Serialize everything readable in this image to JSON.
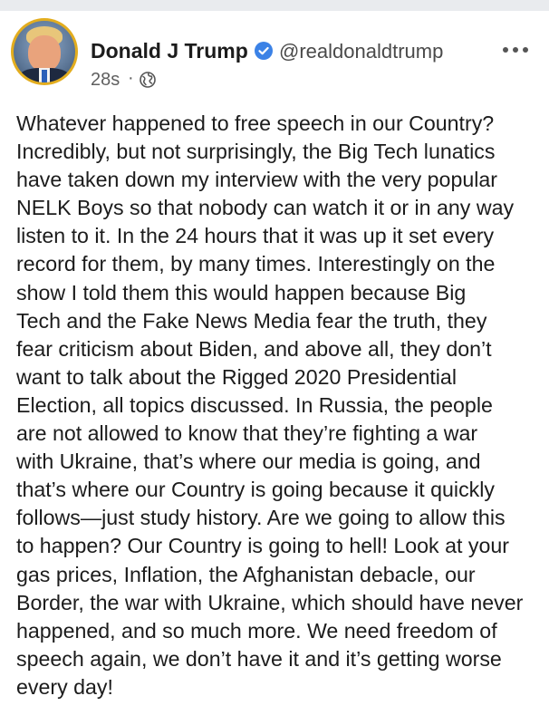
{
  "author": {
    "display_name": "Donald J Trump",
    "handle": "@realdonaldtrump",
    "verified": true,
    "avatar_icon": "profile-photo"
  },
  "meta": {
    "timestamp": "28s",
    "separator": "·",
    "audience_icon": "globe-icon"
  },
  "post": {
    "lines": [
      "Whatever happened to free speech in our Country?",
      "Incredibly, but not surprisingly, the Big Tech lunatics",
      "have taken down my interview with the very popular",
      "NELK Boys so that nobody can watch it or in any way",
      "listen to it. In the 24 hours that it was up it set every",
      "record for them, by many times. Interestingly on the",
      "show I told them this would happen because Big",
      "Tech and the Fake News Media fear the truth, they",
      "fear criticism about Biden, and above all, they don’t",
      "want to talk about the Rigged 2020 Presidential",
      "Election, all topics discussed. In Russia, the people",
      "are not allowed to know that they’re fighting a war",
      "with Ukraine, that’s where our media is going, and",
      "that’s where our Country is going because it quickly",
      "follows—just study history. Are we going to allow this",
      "to happen? Our Country is going to hell! Look at your",
      "gas prices, Inflation, the Afghanistan debacle, our",
      "Border, the war with Ukraine, which should have never",
      "happened, and so much more. We need freedom of",
      "speech again, we don’t have it and it’s getting worse",
      "every day!"
    ]
  },
  "colors": {
    "verified_blue": "#3b82e6",
    "avatar_ring": "#e3ad1e",
    "text": "#1c1c1c",
    "muted": "#5f5f5f"
  }
}
